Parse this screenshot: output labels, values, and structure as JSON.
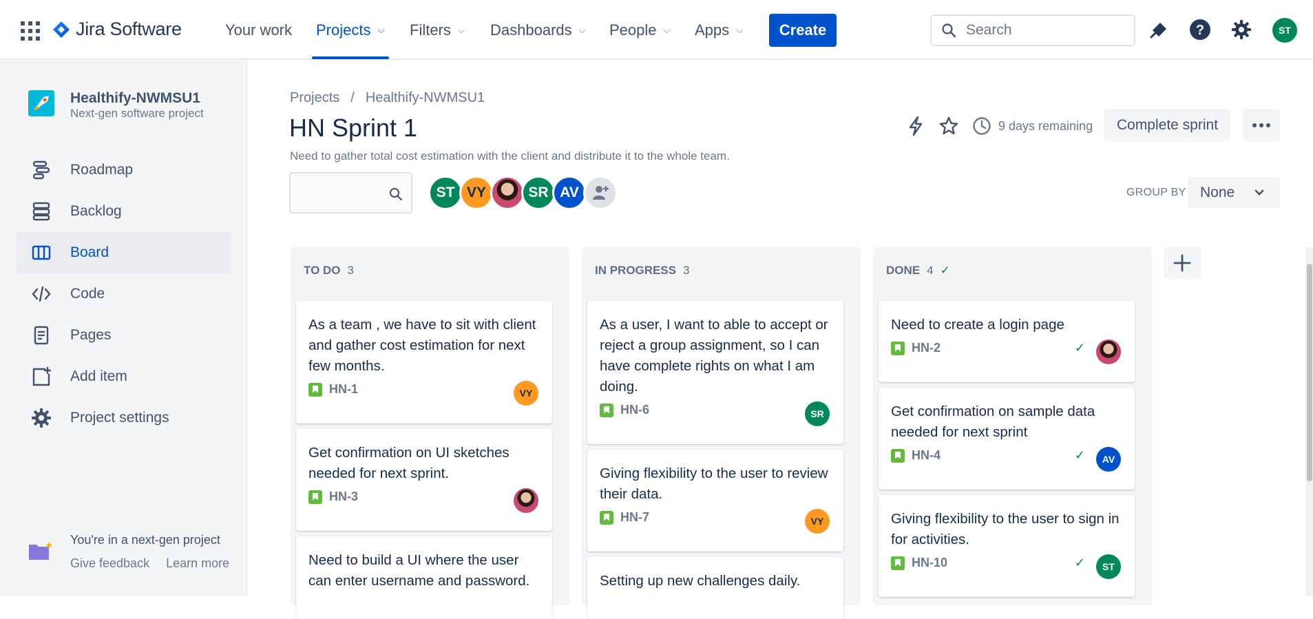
{
  "app": {
    "name": "Jira Software"
  },
  "nav": {
    "your_work": "Your work",
    "projects": "Projects",
    "filters": "Filters",
    "dashboards": "Dashboards",
    "people": "People",
    "apps": "Apps",
    "create": "Create",
    "search_placeholder": "Search",
    "user_initials": "ST"
  },
  "sidebar": {
    "project_name": "Healthify-NWMSU1",
    "project_type": "Next-gen software project",
    "items": [
      {
        "label": "Roadmap",
        "icon": "roadmap-icon"
      },
      {
        "label": "Backlog",
        "icon": "backlog-icon"
      },
      {
        "label": "Board",
        "icon": "board-icon",
        "active": true
      },
      {
        "label": "Code",
        "icon": "code-icon"
      },
      {
        "label": "Pages",
        "icon": "pages-icon"
      },
      {
        "label": "Add item",
        "icon": "add-item-icon"
      },
      {
        "label": "Project settings",
        "icon": "gear-icon"
      }
    ],
    "footer_text": "You're in a next-gen project",
    "give_feedback": "Give feedback",
    "learn_more": "Learn more"
  },
  "breadcrumb": {
    "root": "Projects",
    "sep": "/",
    "project": "Healthify-NWMSU1"
  },
  "sprint": {
    "title": "HN Sprint 1",
    "goal": "Need to gather total cost estimation with the client and distribute it to the whole team.",
    "days_remaining": "9 days remaining",
    "complete_label": "Complete sprint"
  },
  "filters": {
    "avatars": [
      {
        "initials": "ST",
        "color": "#00875a"
      },
      {
        "initials": "VY",
        "color": "#ff991f"
      },
      {
        "initials": "",
        "photo": true
      },
      {
        "initials": "SR",
        "color": "#00875a"
      },
      {
        "initials": "AV",
        "color": "#0052cc"
      }
    ],
    "group_by_label": "GROUP BY",
    "group_by_value": "None"
  },
  "columns": [
    {
      "name": "TO DO",
      "count": "3",
      "done": false,
      "cards": [
        {
          "title": "As a team , we have to sit with client and gather cost estimation for next few months.",
          "key": "HN-1",
          "assignee": "VY",
          "color": "#ff991f"
        },
        {
          "title": "Get confirmation on UI sketches needed for next sprint.",
          "key": "HN-3",
          "assignee": "",
          "photo": true
        },
        {
          "title": "Need to build a UI where the user can enter username and password.",
          "key": "",
          "assignee": ""
        }
      ]
    },
    {
      "name": "IN PROGRESS",
      "count": "3",
      "done": false,
      "cards": [
        {
          "title": "As a user, I want to able to accept or reject a group assignment, so I can have complete rights on what I am doing.",
          "key": "HN-6",
          "assignee": "SR",
          "color": "#00875a"
        },
        {
          "title": "Giving flexibility to the user to review their data.",
          "key": "HN-7",
          "assignee": "VY",
          "color": "#ff991f"
        },
        {
          "title": "Setting up new challenges daily.",
          "key": "",
          "assignee": ""
        }
      ]
    },
    {
      "name": "DONE",
      "count": "4",
      "done": true,
      "cards": [
        {
          "title": "Need to create a login page",
          "key": "HN-2",
          "assignee": "",
          "photo": true
        },
        {
          "title": "Get confirmation on sample data needed for next sprint",
          "key": "HN-4",
          "assignee": "AV",
          "color": "#0052cc"
        },
        {
          "title": "Giving flexibility to the user to sign in for activities.",
          "key": "HN-10",
          "assignee": "ST",
          "color": "#00875a"
        }
      ]
    }
  ]
}
